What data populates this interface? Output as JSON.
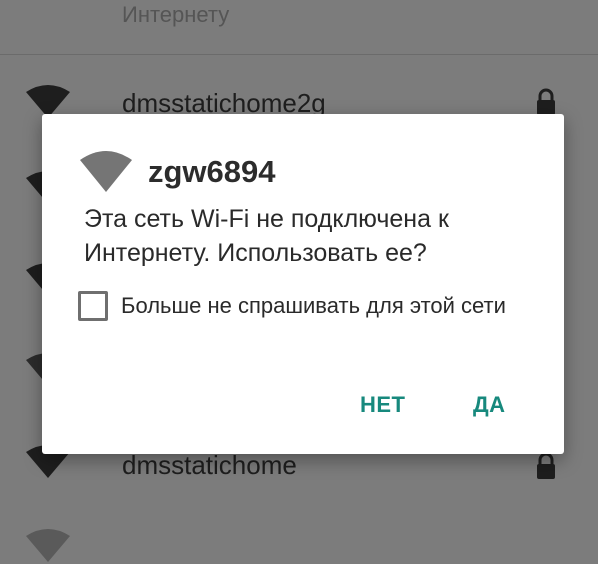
{
  "background": {
    "subtext": "Интернету",
    "networks": [
      {
        "ssid": "dmsstatichome2g",
        "locked": true
      },
      {
        "ssid": "",
        "locked": true
      },
      {
        "ssid": "",
        "locked": true
      },
      {
        "ssid": "",
        "locked": true
      },
      {
        "ssid": "dmsstatichome",
        "locked": true
      }
    ]
  },
  "dialog": {
    "icon": "wifi-icon",
    "title": "zgw6894",
    "message": "Эта сеть Wi-Fi не подключена к Интернету. Использовать ее?",
    "checkbox_label": "Больше не спрашивать для этой сети",
    "checkbox_checked": false,
    "button_no": "НЕТ",
    "button_yes": "ДА"
  },
  "colors": {
    "accent": "#17897d",
    "scrim": "#7c7c7c",
    "dialog_bg": "#ffffff"
  }
}
